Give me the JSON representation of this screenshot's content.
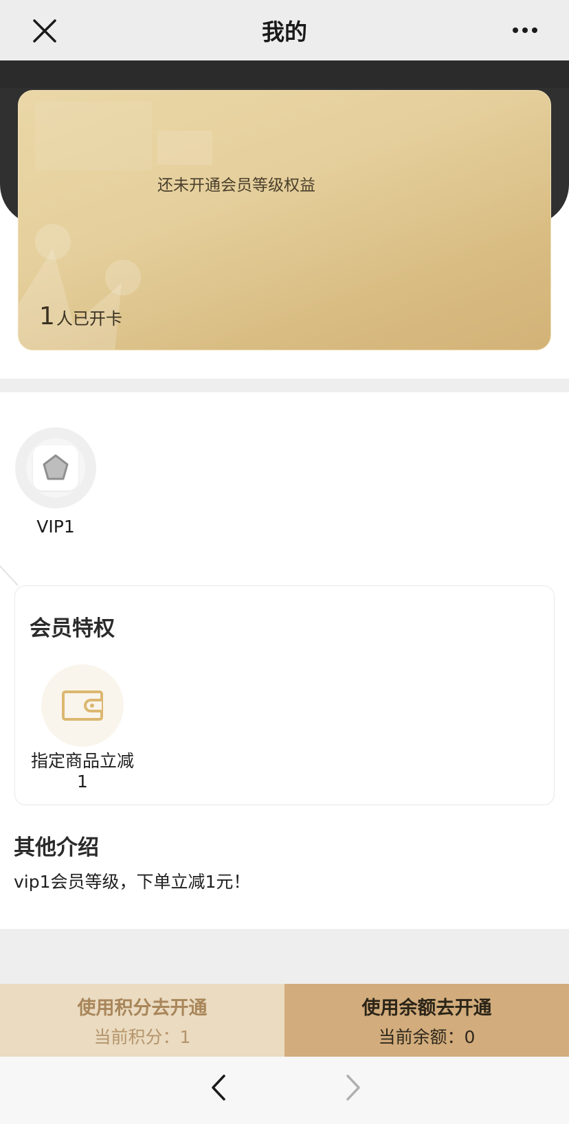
{
  "navbar": {
    "title": "我的",
    "close_icon": "close-icon",
    "more_icon": "more-dots-icon"
  },
  "card": {
    "status_text": "还未开通会员等级权益",
    "count_number": "1",
    "count_label": "人已开卡",
    "colors": {
      "gold_light": "#ead7a7",
      "gold_dark": "#d3b277"
    }
  },
  "vip": {
    "level_label": "VIP1",
    "badge_icon": "pentagon-star-icon"
  },
  "privileges": {
    "title": "会员特权",
    "items": [
      {
        "icon": "wallet-icon",
        "label": "指定商品立减1"
      }
    ]
  },
  "intro": {
    "title": "其他介绍",
    "text": "vip1会员等级，下单立减1元！"
  },
  "actions": {
    "points": {
      "label": "使用积分去开通",
      "sub": "当前积分：1"
    },
    "balance": {
      "label": "使用余额去开通",
      "sub": "当前余额：0"
    }
  },
  "browser_nav": {
    "back_icon": "chevron-left-icon",
    "forward_icon": "chevron-right-icon"
  }
}
